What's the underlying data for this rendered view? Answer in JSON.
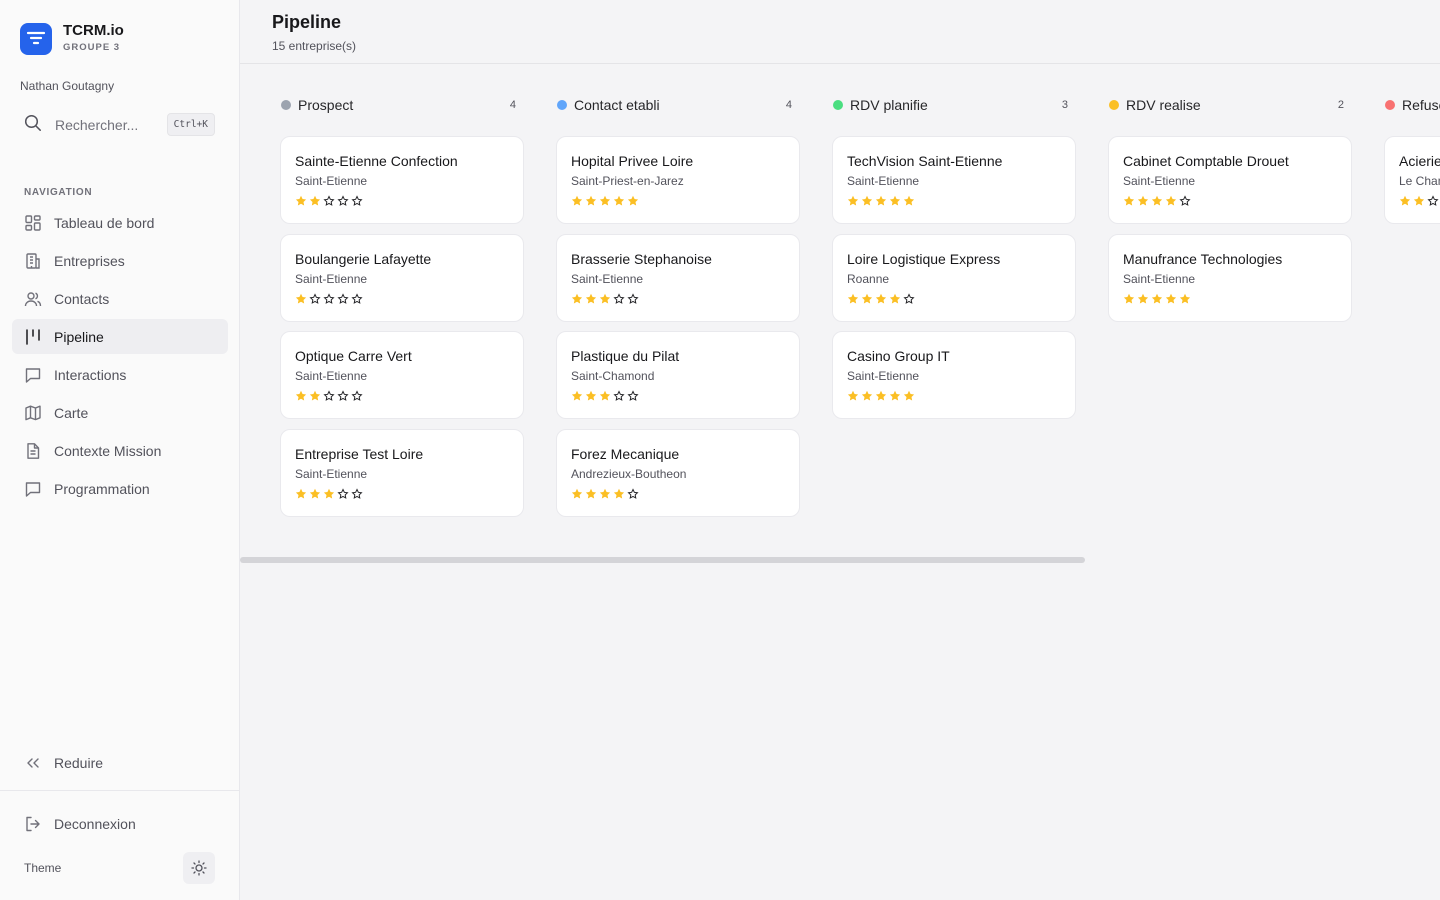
{
  "app": {
    "name": "TCRM.io",
    "group": "GROUPE 3",
    "user": "Nathan Goutagny"
  },
  "search": {
    "label": "Rechercher...",
    "shortcut": "Ctrl+K"
  },
  "navigation": {
    "heading": "NAVIGATION",
    "items": [
      {
        "label": "Tableau de bord",
        "icon": "dashboard-icon",
        "active": false
      },
      {
        "label": "Entreprises",
        "icon": "building-icon",
        "active": false
      },
      {
        "label": "Contacts",
        "icon": "users-icon",
        "active": false
      },
      {
        "label": "Pipeline",
        "icon": "pipeline-icon",
        "active": true
      },
      {
        "label": "Interactions",
        "icon": "message-icon",
        "active": false
      },
      {
        "label": "Carte",
        "icon": "map-icon",
        "active": false
      },
      {
        "label": "Contexte Mission",
        "icon": "document-icon",
        "active": false
      },
      {
        "label": "Programmation",
        "icon": "message-icon",
        "active": false
      }
    ]
  },
  "sidebar_footer": {
    "collapse_label": "Reduire",
    "logout_label": "Deconnexion",
    "theme_label": "Theme"
  },
  "page": {
    "title": "Pipeline",
    "subtitle": "15 entreprise(s)"
  },
  "colors": {
    "accent": "#2563eb",
    "star": "#fbbf24",
    "star_empty": "#27272a"
  },
  "columns": [
    {
      "title": "Prospect",
      "count": "4",
      "color": "#9ca3af",
      "cards": [
        {
          "name": "Sainte-Etienne Confection",
          "city": "Saint-Etienne",
          "rating": 2
        },
        {
          "name": "Boulangerie Lafayette",
          "city": "Saint-Etienne",
          "rating": 1
        },
        {
          "name": "Optique Carre Vert",
          "city": "Saint-Etienne",
          "rating": 2
        },
        {
          "name": "Entreprise Test Loire",
          "city": "Saint-Etienne",
          "rating": 3
        }
      ]
    },
    {
      "title": "Contact etabli",
      "count": "4",
      "color": "#60a5fa",
      "cards": [
        {
          "name": "Hopital Privee Loire",
          "city": "Saint-Priest-en-Jarez",
          "rating": 5
        },
        {
          "name": "Brasserie Stephanoise",
          "city": "Saint-Etienne",
          "rating": 3
        },
        {
          "name": "Plastique du Pilat",
          "city": "Saint-Chamond",
          "rating": 3
        },
        {
          "name": "Forez Mecanique",
          "city": "Andrezieux-Boutheon",
          "rating": 4
        }
      ]
    },
    {
      "title": "RDV planifie",
      "count": "3",
      "color": "#4ade80",
      "cards": [
        {
          "name": "TechVision Saint-Etienne",
          "city": "Saint-Etienne",
          "rating": 5
        },
        {
          "name": "Loire Logistique Express",
          "city": "Roanne",
          "rating": 4
        },
        {
          "name": "Casino Group IT",
          "city": "Saint-Etienne",
          "rating": 5
        }
      ]
    },
    {
      "title": "RDV realise",
      "count": "2",
      "color": "#fbbf24",
      "cards": [
        {
          "name": "Cabinet Comptable Drouet",
          "city": "Saint-Etienne",
          "rating": 4
        },
        {
          "name": "Manufrance Technologies",
          "city": "Saint-Etienne",
          "rating": 5
        }
      ]
    },
    {
      "title": "Refuse",
      "count": "",
      "color": "#f87171",
      "cards": [
        {
          "name": "Acierie",
          "city": "Le Chambon",
          "rating": 2
        }
      ]
    }
  ]
}
